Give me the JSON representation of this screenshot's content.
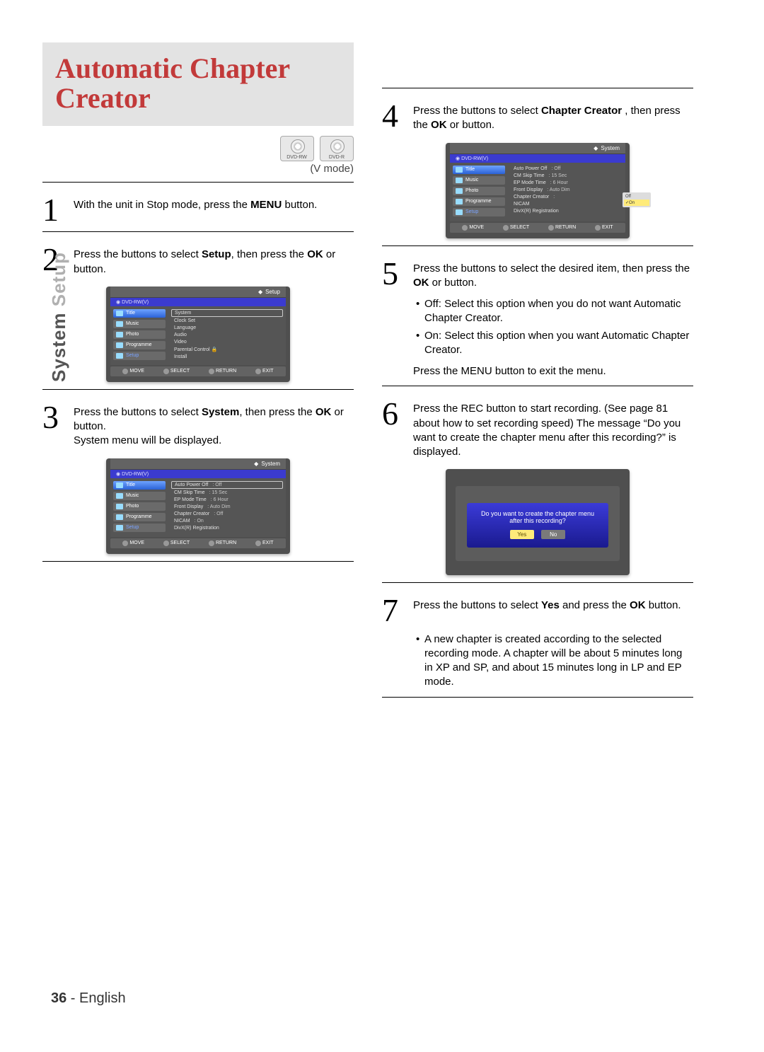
{
  "sideLabel": {
    "sys": "System",
    "setup": " Setup"
  },
  "title": "Automatic Chapter Creator",
  "vmode": "(V mode)",
  "discs": [
    "DVD-RW",
    "DVD-R"
  ],
  "steps": {
    "s1": {
      "n": "1",
      "text_a": "With the unit in Stop mode, press the ",
      "term": "MENU",
      "text_b": " button."
    },
    "s2": {
      "n": "2",
      "text_a": "Press the       buttons to select ",
      "term": "Setup",
      "text_b": ", then press the ",
      "term2": "OK",
      "text_c": " or      button."
    },
    "s3": {
      "n": "3",
      "text_a": "Press the       buttons to select ",
      "term": "System",
      "text_b": ", then press the ",
      "term2": "OK",
      "text_c": " or      button.",
      "extra": "System menu will be displayed."
    },
    "s4": {
      "n": "4",
      "text_a": "Press the       buttons to select ",
      "term": "Chapter Creator",
      "text_b": " , then press the ",
      "term2": "OK",
      "text_c": " or      button."
    },
    "s5": {
      "n": "5",
      "text_a": "Press the       buttons to select the desired item, then press the ",
      "term": "OK",
      "text_b": " or      button.",
      "bullets": [
        "Off: Select this option when you do not want Automatic Chapter Creator.",
        "On: Select this option when you want Automatic Chapter Creator."
      ],
      "after": "Press the MENU button to exit the menu."
    },
    "s6": {
      "n": "6",
      "text": "Press the REC button to start recording. (See page 81 about how to set recording speed) The message “Do you want to create the chapter menu after this recording?” is displayed."
    },
    "s7": {
      "n": "7",
      "text_a": "Press the        buttons to select ",
      "term": "Yes",
      "text_b": " and press the ",
      "term2": "OK",
      "text_c": " button.",
      "bullets": [
        "A new chapter is created according to the selected recording mode. A chapter will be about 5 minutes long in XP and SP, and about 15 minutes long in LP and EP mode."
      ]
    }
  },
  "menu_common": {
    "sub": "DVD-RW(V)",
    "left": [
      "Title",
      "Music",
      "Photo",
      "Programme",
      "Setup"
    ],
    "footer": [
      "MOVE",
      "SELECT",
      "RETURN",
      "EXIT"
    ]
  },
  "shot2": {
    "header": "Setup",
    "opts": [
      "System",
      "Clock Set",
      "Language",
      "Audio",
      "Video",
      "Parental Control",
      "Install"
    ]
  },
  "shot3": {
    "header": "System",
    "kv": [
      {
        "k": "Auto Power Off",
        "v": ": Off"
      },
      {
        "k": "CM Skip Time",
        "v": ": 15 Sec"
      },
      {
        "k": "EP Mode Time",
        "v": ": 6 Hour"
      },
      {
        "k": "Front Display",
        "v": ": Auto Dim"
      },
      {
        "k": "Chapter Creator",
        "v": ": Off"
      },
      {
        "k": "NICAM",
        "v": ": On"
      },
      {
        "k": "DivX(R) Registration",
        "v": ""
      }
    ]
  },
  "shot4": {
    "header": "System",
    "kv": [
      {
        "k": "Auto Power Off",
        "v": ": Off"
      },
      {
        "k": "CM Skip Time",
        "v": ": 15 Sec"
      },
      {
        "k": "EP Mode Time",
        "v": ": 6 Hour"
      },
      {
        "k": "Front Display",
        "v": ": Auto Dim"
      },
      {
        "k": "Chapter Creator",
        "v": ":"
      },
      {
        "k": "NICAM",
        "v": ""
      },
      {
        "k": "DivX(R) Registration",
        "v": ""
      }
    ],
    "dropdown": [
      "Off",
      "On"
    ]
  },
  "dialog": {
    "line1": "Do you want to create the chapter menu",
    "line2": "after this recording?",
    "yes": "Yes",
    "no": "No"
  },
  "footer": {
    "page": "36",
    "dash": " - ",
    "lang": "English"
  }
}
